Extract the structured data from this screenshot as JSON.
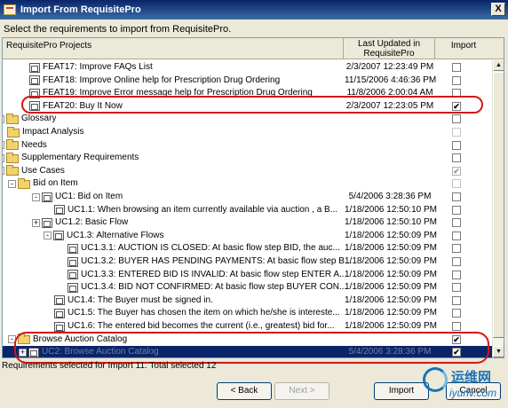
{
  "window": {
    "title": "Import From RequisitePro",
    "close_glyph": "X"
  },
  "instruction": "Select the requirements to import from RequisitePro.",
  "columns": {
    "name": "RequisitePro Projects",
    "date": "Last Updated in RequisitePro",
    "import": "Import"
  },
  "rows": [
    {
      "label": "FEAT17: Improve FAQs List",
      "date": "2/3/2007 12:23:49 PM",
      "checked": false,
      "icon": "requirement-icon"
    },
    {
      "label": "FEAT18: Improve Online help for Prescription Drug Ordering",
      "date": "11/15/2006 4:46:36 PM",
      "checked": false,
      "icon": "requirement-icon"
    },
    {
      "label": "FEAT19: Improve Error message help for Prescription Drug Ordering",
      "date": "11/8/2006 2:00:04 AM",
      "checked": false,
      "icon": "requirement-icon"
    },
    {
      "label": "FEAT20: Buy It Now",
      "date": "2/3/2007 12:23:05 PM",
      "checked": true,
      "icon": "requirement-icon"
    },
    {
      "label": "Glossary",
      "date": "",
      "checked": false,
      "icon": "folder-icon",
      "expander": "+"
    },
    {
      "label": "Impact Analysis",
      "date": "",
      "checked": false,
      "icon": "folder-icon"
    },
    {
      "label": "Needs",
      "date": "",
      "checked": false,
      "icon": "folder-icon",
      "expander": "+"
    },
    {
      "label": "Supplementary Requirements",
      "date": "",
      "checked": false,
      "icon": "folder-icon",
      "expander": "+"
    },
    {
      "label": "Use Cases",
      "date": "",
      "checked": true,
      "icon": "folder-icon",
      "expander": "-"
    },
    {
      "label": "Bid on Item",
      "date": "",
      "checked": false,
      "icon": "folder-icon",
      "expander": "-"
    },
    {
      "label": "UC1: Bid on Item",
      "date": "5/4/2006 3:28:36 PM",
      "checked": false,
      "icon": "requirement-icon",
      "expander": "-"
    },
    {
      "label": "UC1.1: When browsing an item currently available via auction , a B...",
      "date": "1/18/2006 12:50:10 PM",
      "checked": false,
      "icon": "requirement-icon"
    },
    {
      "label": "UC1.2: Basic Flow",
      "date": "1/18/2006 12:50:10 PM",
      "checked": false,
      "icon": "requirement-icon",
      "expander": "+"
    },
    {
      "label": "UC1.3: Alternative Flows",
      "date": "1/18/2006 12:50:09 PM",
      "checked": false,
      "icon": "requirement-icon",
      "expander": "-"
    },
    {
      "label": "UC1.3.1: AUCTION IS CLOSED:  At basic flow step BID, the auc...",
      "date": "1/18/2006 12:50:09 PM",
      "checked": false,
      "icon": "requirement-icon"
    },
    {
      "label": "UC1.3.2: BUYER HAS PENDING PAYMENTS:  At basic flow step B...",
      "date": "1/18/2006 12:50:09 PM",
      "checked": false,
      "icon": "requirement-icon"
    },
    {
      "label": "UC1.3.3: ENTERED BID IS INVALID:  At basic flow step ENTER A...",
      "date": "1/18/2006 12:50:09 PM",
      "checked": false,
      "icon": "requirement-icon"
    },
    {
      "label": "UC1.3.4: BID NOT CONFIRMED:  At basic flow step BUYER CON...",
      "date": "1/18/2006 12:50:09 PM",
      "checked": false,
      "icon": "requirement-icon"
    },
    {
      "label": "UC1.4: The Buyer must be signed in.",
      "date": "1/18/2006 12:50:09 PM",
      "checked": false,
      "icon": "requirement-icon"
    },
    {
      "label": "UC1.5: The Buyer has chosen the item on which he/she is intereste...",
      "date": "1/18/2006 12:50:09 PM",
      "checked": false,
      "icon": "requirement-icon"
    },
    {
      "label": "UC1.6: The entered bid becomes the current (i.e., greatest) bid for...",
      "date": "1/18/2006 12:50:09 PM",
      "checked": false,
      "icon": "requirement-icon"
    },
    {
      "label": "Browse Auction Catalog",
      "date": "",
      "checked": true,
      "icon": "folder-icon",
      "expander": "-"
    },
    {
      "label": "UC2: Browse Auction Catalog",
      "date": "5/4/2006 3:28:36 PM",
      "checked": true,
      "icon": "requirement-icon",
      "expander": "+",
      "selected": true
    }
  ],
  "status": "Requirements selected for Import 11. Total selected 12",
  "buttons": {
    "back": "< Back",
    "next": "Next >",
    "import": "Import",
    "cancel": "Cancel"
  },
  "watermark": {
    "cn": "运维网",
    "url": "iyunv.com"
  },
  "colors": {
    "highlight": "#d01818",
    "selection": "#0a246a",
    "title_bar": "#0a246a"
  }
}
